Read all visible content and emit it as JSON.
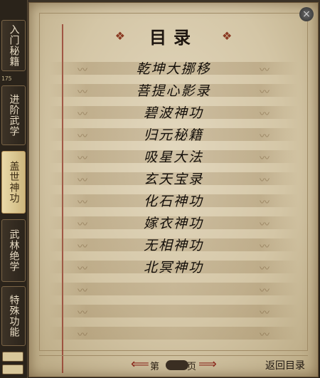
{
  "tabs": [
    {
      "label": "入门秘籍",
      "active": false
    },
    {
      "label": "进阶武学",
      "active": false
    },
    {
      "label": "盖世神功",
      "active": true
    },
    {
      "label": "武林绝学",
      "active": false
    },
    {
      "label": "特殊功能",
      "active": false
    }
  ],
  "tab_badge": "175",
  "title": "目录",
  "skills": [
    "乾坤大挪移",
    "菩提心影录",
    "碧波神功",
    "归元秘籍",
    "吸星大法",
    "玄天宝录",
    "化石神功",
    "嫁衣神功",
    "无相神功",
    "北冥神功"
  ],
  "pager": {
    "prefix": "第",
    "suffix": "页"
  },
  "back_label": "返回目录",
  "close_glyph": "×",
  "mini_icons": [
    "",
    ""
  ],
  "colors": {
    "parchment": "#d4c6a6",
    "accent_red": "#8d2a1e",
    "active_tab": "#e9d9a8"
  }
}
